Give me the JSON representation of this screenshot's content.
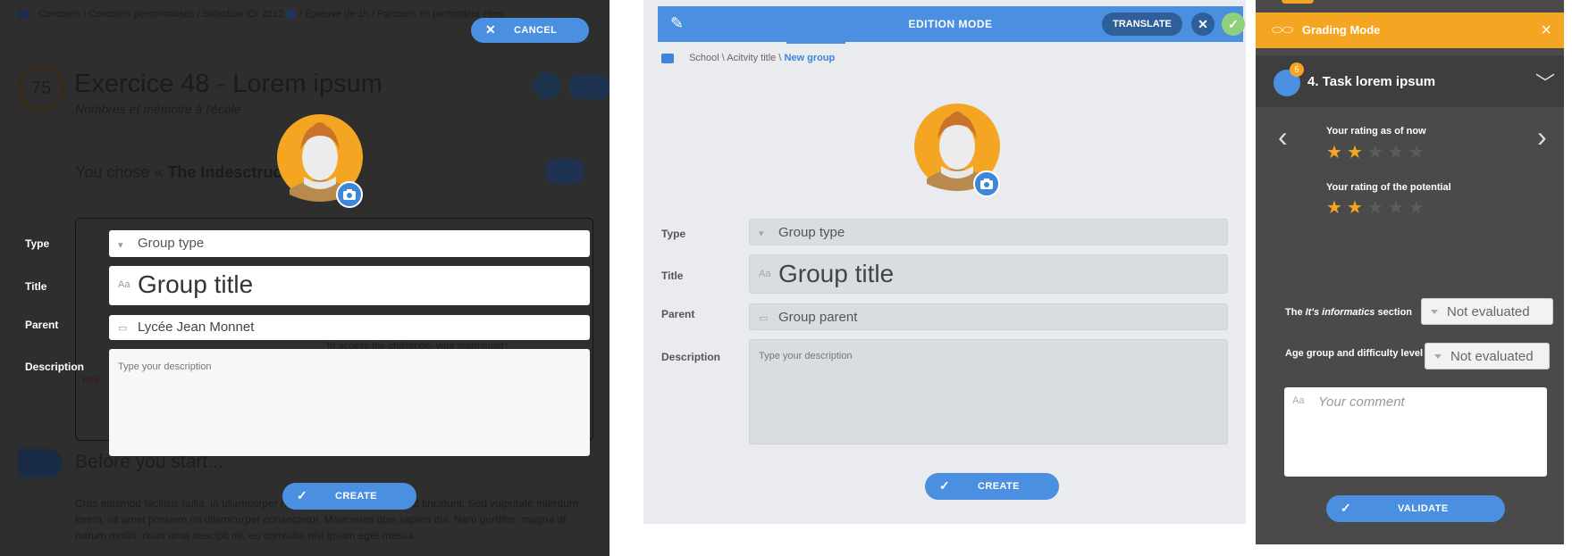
{
  "left": {
    "background": {
      "breadcrumb": "Concours / Concours personnalisés / Sélection IOI 2012",
      "breadcrumb_tail": "/ Épreuve de 1h / Parcours en profondeur  Hors",
      "score": "75",
      "title": "Exercice 48 - Lorem ipsum",
      "subtitle": "Nombres et mémoire à l'école",
      "chose_prefix": "You chose « ",
      "chose_bold": "The Indesctructib",
      "access_note": "To access the challenge, your team must :",
      "red_note": "Your",
      "before": "Before you start...",
      "lorem": "Cras euismod facilisis nulla, in ullamcorper nunc ... quis volutpat tortor at tincidunt. Sed vulputate interdum lorem, sit amet posuere mi ullamcorper consectetur. Maecenas quis sapien dui. Nam porttitor, magna at rutrum mollis, risus urna suscipit mi, eu convallis nisl ipsum eget massa."
    },
    "cancel_label": "CANCEL",
    "type_label": "Type",
    "type_value": "Group type",
    "title_label": "Title",
    "title_value": "Group title",
    "parent_label": "Parent",
    "parent_value": "Lycée Jean Monnet",
    "description_label": "Description",
    "description_placeholder": "Type your description",
    "create_label": "CREATE"
  },
  "middle": {
    "mode": "EDITION MODE",
    "translate_label": "TRANSLATE",
    "breadcrumb": "School \\ Acitvity title \\ ",
    "breadcrumb_current": "New group",
    "type_label": "Type",
    "type_value": "Group type",
    "title_label": "Title",
    "title_value": "Group title",
    "parent_label": "Parent",
    "parent_value": "Group parent",
    "description_label": "Description",
    "description_placeholder": "Type your description",
    "create_label": "CREATE"
  },
  "right": {
    "title": "Grading Mode",
    "task_badge": "5",
    "task_name": "4. Task lorem ipsum",
    "rating_now_label": "Your rating as of now",
    "rating_now": 2,
    "rating_potential_label": "Your rating of the potential",
    "rating_potential": 2,
    "rating_max": 5,
    "section_prefix": "The ",
    "section_italic": "It's informatics",
    "section_suffix": " section",
    "section_value": "Not evaluated",
    "age_label": "Age group and difficulty level",
    "age_value": "Not evaluated",
    "comment_placeholder": "Your comment",
    "validate_label": "VALIDATE"
  },
  "colors": {
    "accent": "#4a8fe0",
    "grading": "#f4a623",
    "success": "#8fd17a"
  }
}
